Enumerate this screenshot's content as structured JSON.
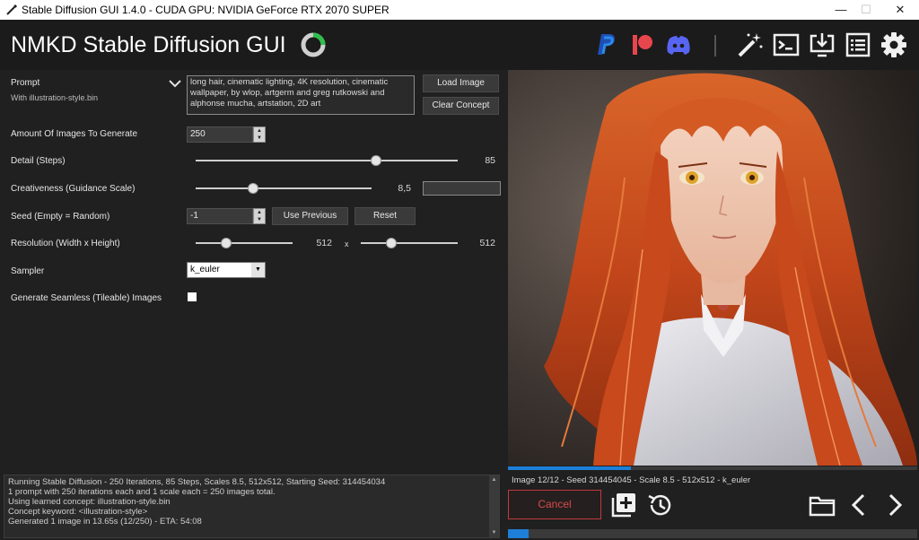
{
  "window": {
    "title": "Stable Diffusion GUI 1.4.0 - CUDA GPU: NVIDIA GeForce RTX 2070 SUPER",
    "minimize_icon": "minimize-icon",
    "maximize_icon": "maximize-icon",
    "close_icon": "close-icon"
  },
  "header": {
    "title": "NMKD Stable Diffusion GUI",
    "icons": [
      "paypal-icon",
      "patreon-icon",
      "discord-icon",
      "magic-wand-icon",
      "terminal-icon",
      "download-icon",
      "list-icon",
      "gear-icon"
    ]
  },
  "form": {
    "prompt_label": "Prompt",
    "prompt_sublabel": "With illustration-style.bin",
    "prompt_text": "long hair, cinematic lighting, 4K resolution, cinematic wallpaper, by wlop,  artgerm and greg rutkowski and alphonse mucha, artstation, 2D art",
    "load_image_label": "Load Image",
    "clear_concept_label": "Clear Concept",
    "amount_label": "Amount Of Images To Generate",
    "amount_value": "250",
    "steps_label": "Detail (Steps)",
    "steps_value": "85",
    "guidance_label": "Creativeness (Guidance Scale)",
    "guidance_value": "8,5",
    "guidance_input": "",
    "seed_label": "Seed (Empty = Random)",
    "seed_value": "-1",
    "use_previous_label": "Use Previous",
    "reset_label": "Reset",
    "resolution_label": "Resolution (Width x Height)",
    "width_value": "512",
    "x_separator": "x",
    "height_value": "512",
    "sampler_label": "Sampler",
    "sampler_value": "k_euler",
    "seamless_label": "Generate Seamless (Tileable) Images",
    "seamless_checked": false
  },
  "log": {
    "lines": [
      "Running Stable Diffusion - 250 Iterations, 85 Steps, Scales 8.5, 512x512, Starting Seed: 314454034",
      "1 prompt with 250 iterations each and 1 scale each = 250 images total.",
      "Using learned concept: illustration-style.bin",
      "Concept keyword: <illustration-style>",
      "Generated 1 image in 13.65s (12/250) - ETA: 54:08"
    ]
  },
  "output": {
    "image_info": "Image 12/12  - Seed 314454045 - Scale 8.5 - 512x512 - k_euler",
    "image_progress": 0.3,
    "overall_progress": 0.05,
    "cancel_label": "Cancel",
    "icons": [
      "add-image-icon",
      "history-icon",
      "folder-icon",
      "chevron-left-icon",
      "chevron-right-icon"
    ]
  },
  "colors": {
    "accent": "#1e7fd8",
    "cancel": "#d94a4a",
    "background": "#202020"
  }
}
